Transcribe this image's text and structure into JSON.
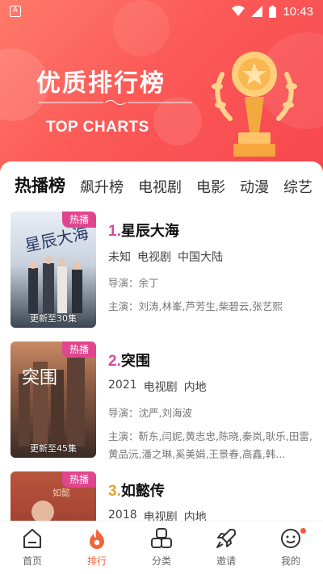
{
  "status_bar": {
    "time": "10:43",
    "left_icon_letter": "A"
  },
  "hero": {
    "title": "优质排行榜",
    "subtitle": "TOP CHARTS"
  },
  "tabs": [
    {
      "label": "热播榜",
      "active": true
    },
    {
      "label": "飙升榜",
      "active": false
    },
    {
      "label": "电视剧",
      "active": false
    },
    {
      "label": "电影",
      "active": false
    },
    {
      "label": "动漫",
      "active": false
    },
    {
      "label": "综艺",
      "active": false
    }
  ],
  "list": [
    {
      "rank": "1.",
      "title": "星辰大海",
      "badge": "热播",
      "meta": [
        "未知",
        "电视剧",
        "中国大陆"
      ],
      "director": "导演：余丁",
      "cast": "主演：刘涛,林峯,芦芳生,柴碧云,张艺熙",
      "poster_caption": "更新至30集"
    },
    {
      "rank": "2.",
      "title": "突围",
      "badge": "热播",
      "meta": [
        "2021",
        "电视剧",
        "内地"
      ],
      "director": "导演：沈严,刘海波",
      "cast": "主演：靳东,闫妮,黄志忠,陈晓,秦岚,耿乐,田雷,黄品沅,潘之琳,奚美娟,王景春,高鑫,韩...",
      "poster_caption": "更新至45集"
    },
    {
      "rank": "3.",
      "title": "如懿传",
      "badge": "热播",
      "meta": [
        "2018",
        "电视剧",
        "内地"
      ],
      "director": "",
      "cast": "",
      "poster_caption": ""
    }
  ],
  "bottom_nav": [
    {
      "label": "首页",
      "icon": "home-icon",
      "active": false
    },
    {
      "label": "排行",
      "icon": "flame-icon",
      "active": true
    },
    {
      "label": "分类",
      "icon": "category-icon",
      "active": false
    },
    {
      "label": "邀请",
      "icon": "rocket-icon",
      "active": false
    },
    {
      "label": "我的",
      "icon": "profile-icon",
      "active": false
    }
  ],
  "colors": {
    "accent": "#f0663c",
    "hero": "#fb5a57",
    "rank1": "#d34ca0",
    "rank3": "#e6a13a",
    "badge": "#e0458f"
  }
}
